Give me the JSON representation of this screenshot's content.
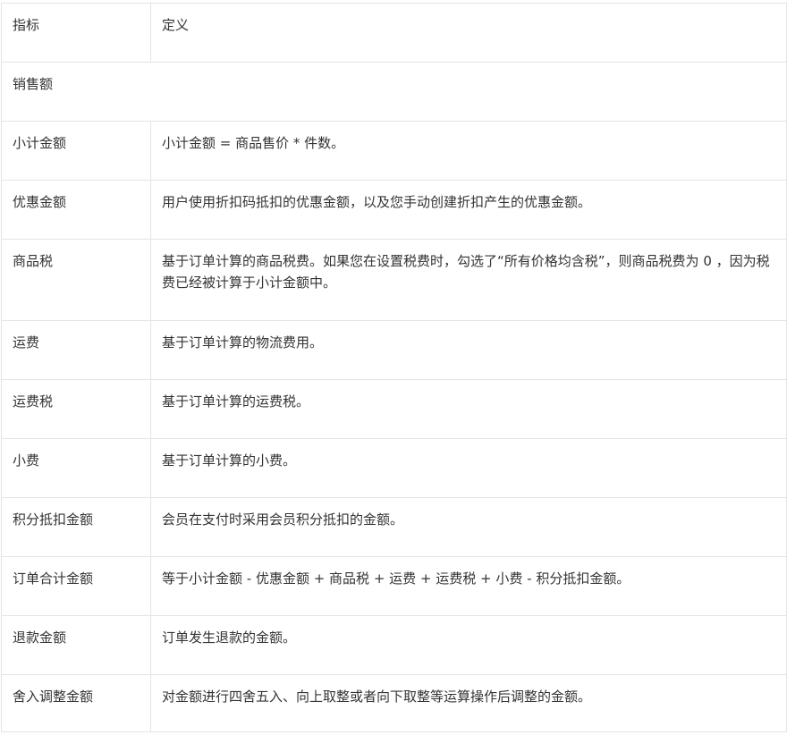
{
  "table": {
    "header": {
      "metric": "指标",
      "definition": "定义"
    },
    "section": "销售额",
    "rows": [
      {
        "metric": "小计金额",
        "definition": "小计金额 = 商品售价 * 件数。"
      },
      {
        "metric": "优惠金额",
        "definition": "用户使用折扣码抵扣的优惠金额，以及您手动创建折扣产生的优惠金额。"
      },
      {
        "metric": "商品税",
        "definition": "基于订单计算的商品税费。如果您在设置税费时，勾选了“所有价格均含税”，则商品税费为 0 ，因为税费已经被计算于小计金额中。"
      },
      {
        "metric": "运费",
        "definition": "基于订单计算的物流费用。"
      },
      {
        "metric": "运费税",
        "definition": "基于订单计算的运费税。"
      },
      {
        "metric": "小费",
        "definition": "基于订单计算的小费。"
      },
      {
        "metric": "积分抵扣金额",
        "definition": "会员在支付时采用会员积分抵扣的金额。"
      },
      {
        "metric": "订单合计金额",
        "definition": "等于小计金额 - 优惠金额 + 商品税 + 运费 + 运费税 + 小费 - 积分抵扣金额。"
      },
      {
        "metric": "退款金额",
        "definition": "订单发生退款的金额。"
      },
      {
        "metric": "舍入调整金额",
        "definition": "对金额进行四舍五入、向上取整或者向下取整等运算操作后调整的金额。"
      }
    ]
  }
}
